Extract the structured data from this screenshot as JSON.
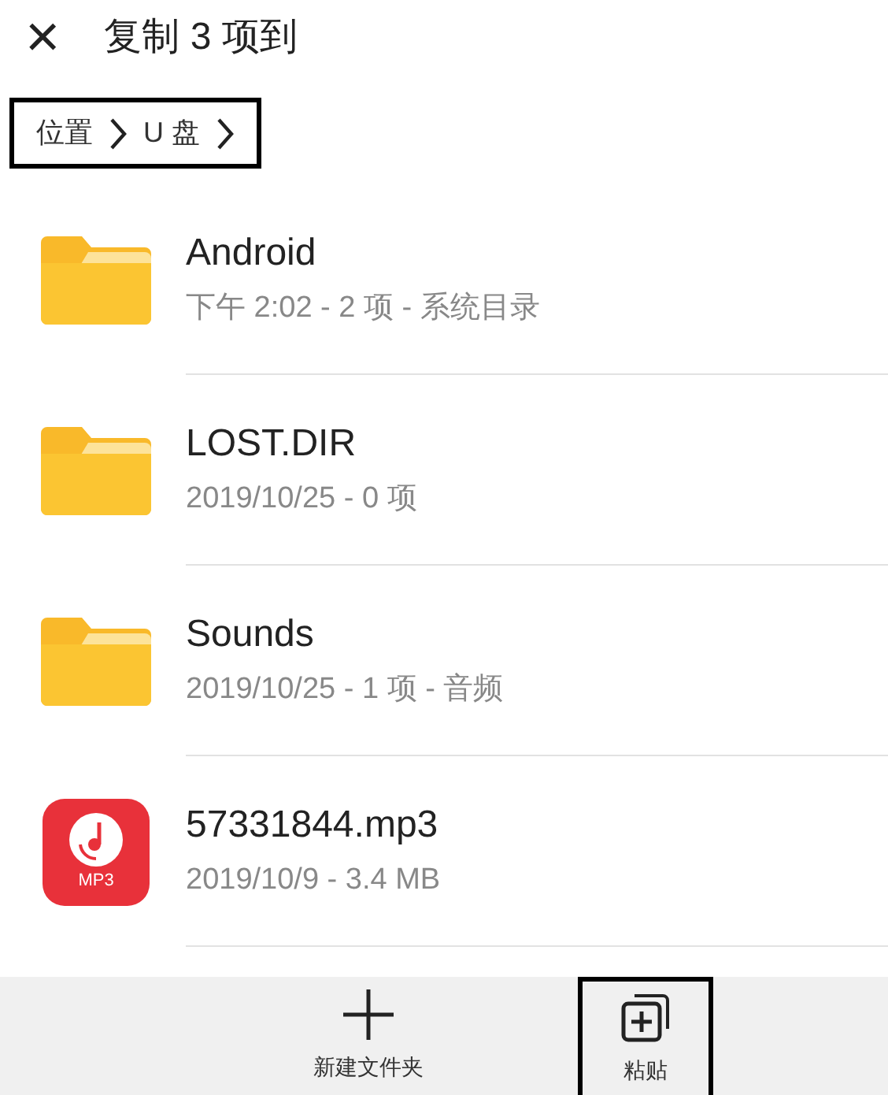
{
  "header": {
    "close": "×",
    "title": "复制 3 项到"
  },
  "breadcrumb": [
    "位置",
    "U 盘"
  ],
  "files": [
    {
      "kind": "folder",
      "name": "Android",
      "details": "下午 2:02 - 2 项 - 系统目录"
    },
    {
      "kind": "folder",
      "name": "LOST.DIR",
      "details": "2019/10/25 - 0 项"
    },
    {
      "kind": "folder",
      "name": "Sounds",
      "details": "2019/10/25 - 1 项 - 音频"
    },
    {
      "kind": "audio",
      "name": "57331844.mp3",
      "details": "2019/10/9 - 3.4 MB",
      "icon_label": "MP3"
    }
  ],
  "toolbar": [
    {
      "kind": "new_folder",
      "label": "新建文件夹",
      "highlighted": false
    },
    {
      "kind": "paste",
      "label": "粘贴",
      "highlighted": true
    }
  ]
}
